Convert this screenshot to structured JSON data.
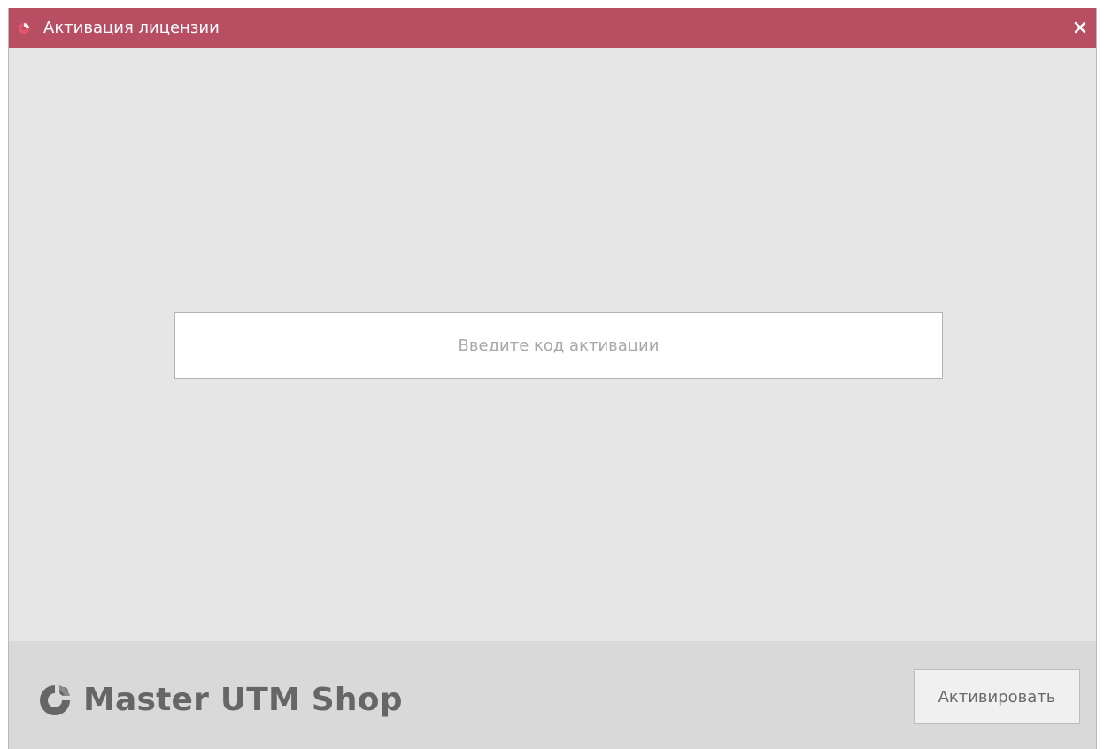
{
  "window": {
    "title": "Активация лицензии",
    "close_label": "×"
  },
  "activation": {
    "input_value": "",
    "input_placeholder": "Введите код активации"
  },
  "footer": {
    "brand_name": "Master UTM Shop",
    "activate_label": "Активировать"
  },
  "colors": {
    "titlebar": "#b84e62",
    "background": "#e6e6e6",
    "footer": "#d9d9d9"
  },
  "icons": {
    "app": "app-logo-icon",
    "close": "close-icon",
    "brand": "brand-logo-icon"
  }
}
